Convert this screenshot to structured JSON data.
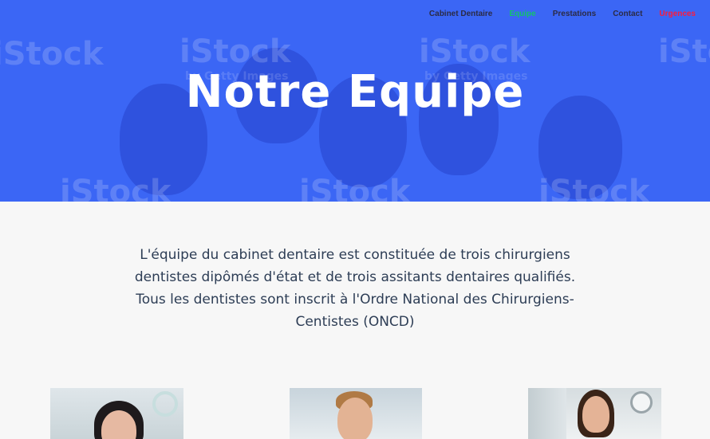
{
  "nav": {
    "items": [
      {
        "label": "Cabinet Dentaire"
      },
      {
        "label": "Equipe"
      },
      {
        "label": "Prestations"
      },
      {
        "label": "Contact"
      },
      {
        "label": "Urgences"
      }
    ]
  },
  "hero": {
    "title": "Notre Equipe",
    "watermark": "iStock",
    "watermark_sub": "by Getty Images"
  },
  "intro": {
    "text": "L'équipe du cabinet dentaire est constituée de trois chirurgiens dentistes dipômés d'état et de trois assitants dentaires qualifiés. Tous les dentistes sont inscrit à l'Ordre National des Chirurgiens-Centistes (ONCD)"
  },
  "colors": {
    "hero_overlay": "#3b66f5",
    "nav_active": "#13c26b",
    "nav_urgent": "#ff1a3a",
    "text": "#2d3d55"
  }
}
